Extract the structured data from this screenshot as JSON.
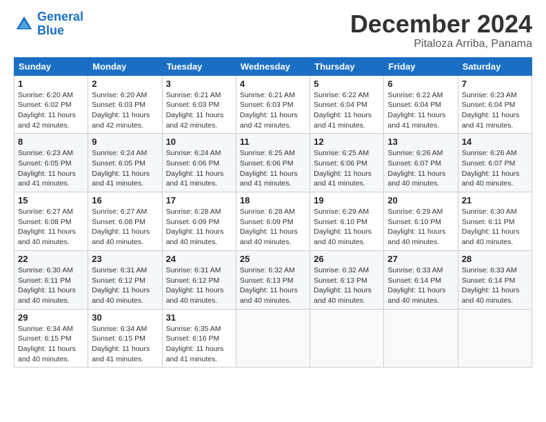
{
  "header": {
    "logo_line1": "General",
    "logo_line2": "Blue",
    "month": "December 2024",
    "location": "Pitaloza Arriba, Panama"
  },
  "days_of_week": [
    "Sunday",
    "Monday",
    "Tuesday",
    "Wednesday",
    "Thursday",
    "Friday",
    "Saturday"
  ],
  "weeks": [
    [
      {
        "day": "1",
        "sunrise": "6:20 AM",
        "sunset": "6:02 PM",
        "daylight": "11 hours and 42 minutes."
      },
      {
        "day": "2",
        "sunrise": "6:20 AM",
        "sunset": "6:03 PM",
        "daylight": "11 hours and 42 minutes."
      },
      {
        "day": "3",
        "sunrise": "6:21 AM",
        "sunset": "6:03 PM",
        "daylight": "11 hours and 42 minutes."
      },
      {
        "day": "4",
        "sunrise": "6:21 AM",
        "sunset": "6:03 PM",
        "daylight": "11 hours and 42 minutes."
      },
      {
        "day": "5",
        "sunrise": "6:22 AM",
        "sunset": "6:04 PM",
        "daylight": "11 hours and 41 minutes."
      },
      {
        "day": "6",
        "sunrise": "6:22 AM",
        "sunset": "6:04 PM",
        "daylight": "11 hours and 41 minutes."
      },
      {
        "day": "7",
        "sunrise": "6:23 AM",
        "sunset": "6:04 PM",
        "daylight": "11 hours and 41 minutes."
      }
    ],
    [
      {
        "day": "8",
        "sunrise": "6:23 AM",
        "sunset": "6:05 PM",
        "daylight": "11 hours and 41 minutes."
      },
      {
        "day": "9",
        "sunrise": "6:24 AM",
        "sunset": "6:05 PM",
        "daylight": "11 hours and 41 minutes."
      },
      {
        "day": "10",
        "sunrise": "6:24 AM",
        "sunset": "6:06 PM",
        "daylight": "11 hours and 41 minutes."
      },
      {
        "day": "11",
        "sunrise": "6:25 AM",
        "sunset": "6:06 PM",
        "daylight": "11 hours and 41 minutes."
      },
      {
        "day": "12",
        "sunrise": "6:25 AM",
        "sunset": "6:06 PM",
        "daylight": "11 hours and 41 minutes."
      },
      {
        "day": "13",
        "sunrise": "6:26 AM",
        "sunset": "6:07 PM",
        "daylight": "11 hours and 40 minutes."
      },
      {
        "day": "14",
        "sunrise": "6:26 AM",
        "sunset": "6:07 PM",
        "daylight": "11 hours and 40 minutes."
      }
    ],
    [
      {
        "day": "15",
        "sunrise": "6:27 AM",
        "sunset": "6:08 PM",
        "daylight": "11 hours and 40 minutes."
      },
      {
        "day": "16",
        "sunrise": "6:27 AM",
        "sunset": "6:08 PM",
        "daylight": "11 hours and 40 minutes."
      },
      {
        "day": "17",
        "sunrise": "6:28 AM",
        "sunset": "6:09 PM",
        "daylight": "11 hours and 40 minutes."
      },
      {
        "day": "18",
        "sunrise": "6:28 AM",
        "sunset": "6:09 PM",
        "daylight": "11 hours and 40 minutes."
      },
      {
        "day": "19",
        "sunrise": "6:29 AM",
        "sunset": "6:10 PM",
        "daylight": "11 hours and 40 minutes."
      },
      {
        "day": "20",
        "sunrise": "6:29 AM",
        "sunset": "6:10 PM",
        "daylight": "11 hours and 40 minutes."
      },
      {
        "day": "21",
        "sunrise": "6:30 AM",
        "sunset": "6:11 PM",
        "daylight": "11 hours and 40 minutes."
      }
    ],
    [
      {
        "day": "22",
        "sunrise": "6:30 AM",
        "sunset": "6:11 PM",
        "daylight": "11 hours and 40 minutes."
      },
      {
        "day": "23",
        "sunrise": "6:31 AM",
        "sunset": "6:12 PM",
        "daylight": "11 hours and 40 minutes."
      },
      {
        "day": "24",
        "sunrise": "6:31 AM",
        "sunset": "6:12 PM",
        "daylight": "11 hours and 40 minutes."
      },
      {
        "day": "25",
        "sunrise": "6:32 AM",
        "sunset": "6:13 PM",
        "daylight": "11 hours and 40 minutes."
      },
      {
        "day": "26",
        "sunrise": "6:32 AM",
        "sunset": "6:13 PM",
        "daylight": "11 hours and 40 minutes."
      },
      {
        "day": "27",
        "sunrise": "6:33 AM",
        "sunset": "6:14 PM",
        "daylight": "11 hours and 40 minutes."
      },
      {
        "day": "28",
        "sunrise": "6:33 AM",
        "sunset": "6:14 PM",
        "daylight": "11 hours and 40 minutes."
      }
    ],
    [
      {
        "day": "29",
        "sunrise": "6:34 AM",
        "sunset": "6:15 PM",
        "daylight": "11 hours and 40 minutes."
      },
      {
        "day": "30",
        "sunrise": "6:34 AM",
        "sunset": "6:15 PM",
        "daylight": "11 hours and 41 minutes."
      },
      {
        "day": "31",
        "sunrise": "6:35 AM",
        "sunset": "6:16 PM",
        "daylight": "11 hours and 41 minutes."
      },
      null,
      null,
      null,
      null
    ]
  ]
}
